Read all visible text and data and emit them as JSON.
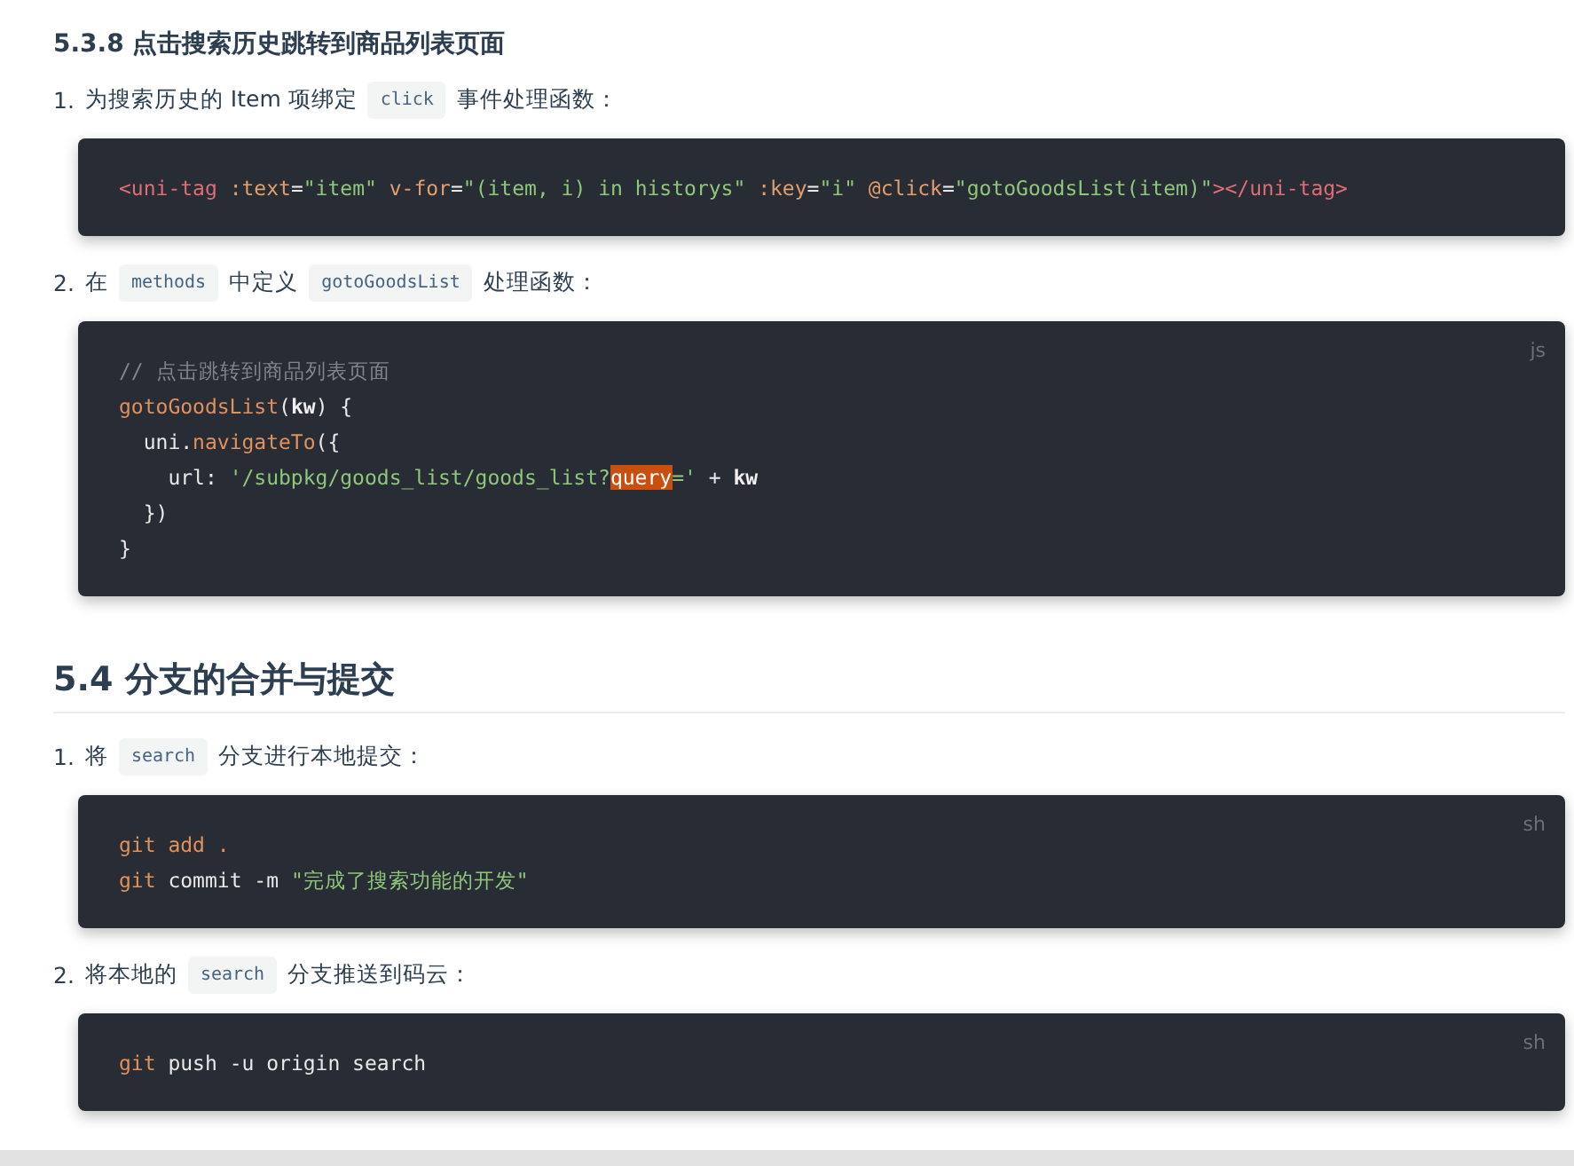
{
  "blocks": [
    {
      "kind": "subsection",
      "number": "5.3.8",
      "title": "点击搜索历史跳转到商品列表页面"
    },
    {
      "kind": "step",
      "number": "1.",
      "parts": [
        {
          "kind": "text",
          "text": "为搜索历史的 Item 项绑定"
        },
        {
          "kind": "code",
          "text": "click"
        },
        {
          "kind": "text",
          "text": "事件处理函数："
        }
      ]
    },
    {
      "kind": "code",
      "lines": [
        [
          {
            "kind": "tag",
            "t": "<uni-tag"
          },
          {
            "kind": "attr",
            "t": " :text"
          },
          {
            "kind": "plain",
            "t": "="
          },
          {
            "kind": "string",
            "t": "\"item\""
          },
          {
            "kind": "attr",
            "t": " v-for"
          },
          {
            "kind": "plain",
            "t": "="
          },
          {
            "kind": "string",
            "t": "\"(item, i) in historys\""
          },
          {
            "kind": "attr",
            "t": " :key"
          },
          {
            "kind": "plain",
            "t": "="
          },
          {
            "kind": "string",
            "t": "\"i\""
          },
          {
            "kind": "attr",
            "t": " @click"
          },
          {
            "kind": "plain",
            "t": "="
          },
          {
            "kind": "string",
            "t": "\"gotoGoodsList(item)\""
          },
          {
            "kind": "tag",
            "t": "></uni-tag>"
          }
        ]
      ]
    },
    {
      "kind": "step",
      "number": "2.",
      "parts": [
        {
          "kind": "text",
          "text": "在"
        },
        {
          "kind": "code",
          "text": "methods"
        },
        {
          "kind": "text",
          "text": "中定义"
        },
        {
          "kind": "code",
          "text": "gotoGoodsList"
        },
        {
          "kind": "text",
          "text": "处理函数："
        }
      ]
    },
    {
      "kind": "code",
      "lang": "js",
      "lines": [
        [
          {
            "kind": "comment",
            "t": "// 点击跳转到商品列表页面"
          }
        ],
        [
          {
            "kind": "func",
            "t": "gotoGoodsList"
          },
          {
            "kind": "plain",
            "t": "("
          },
          {
            "kind": "bold",
            "t": "kw"
          },
          {
            "kind": "plain",
            "t": ") {"
          }
        ],
        [
          {
            "kind": "plain",
            "t": "  uni."
          },
          {
            "kind": "func",
            "t": "navigateTo"
          },
          {
            "kind": "plain",
            "t": "({"
          }
        ],
        [
          {
            "kind": "plain",
            "t": "    url: "
          },
          {
            "kind": "string",
            "t": "'/subpkg/goods_list/goods_list?"
          },
          {
            "kind": "match",
            "t": "query"
          },
          {
            "kind": "string",
            "t": "='"
          },
          {
            "kind": "plain",
            "t": " + "
          },
          {
            "kind": "bold",
            "t": "kw"
          }
        ],
        [
          {
            "kind": "plain",
            "t": "  })"
          }
        ],
        [
          {
            "kind": "plain",
            "t": "}"
          }
        ]
      ]
    },
    {
      "kind": "section",
      "number": "5.4",
      "title": "分支的合并与提交"
    },
    {
      "kind": "step",
      "number": "1.",
      "parts": [
        {
          "kind": "text",
          "text": "将"
        },
        {
          "kind": "code",
          "text": "search"
        },
        {
          "kind": "text",
          "text": "分支进行本地提交："
        }
      ]
    },
    {
      "kind": "code",
      "lang": "sh",
      "lines": [
        [
          {
            "kind": "func",
            "t": "git"
          },
          {
            "kind": "func",
            "t": " add ."
          }
        ],
        [
          {
            "kind": "func",
            "t": "git"
          },
          {
            "kind": "plain",
            "t": " commit -m "
          },
          {
            "kind": "string",
            "t": "\"完成了搜索功能的开发\""
          }
        ]
      ]
    },
    {
      "kind": "step",
      "number": "2.",
      "parts": [
        {
          "kind": "text",
          "text": "将本地的"
        },
        {
          "kind": "code",
          "text": "search"
        },
        {
          "kind": "text",
          "text": "分支推送到码云："
        }
      ]
    },
    {
      "kind": "code",
      "lang": "sh",
      "lines": [
        [
          {
            "kind": "func",
            "t": "git"
          },
          {
            "kind": "plain",
            "t": " push -u origin search"
          }
        ]
      ]
    }
  ]
}
